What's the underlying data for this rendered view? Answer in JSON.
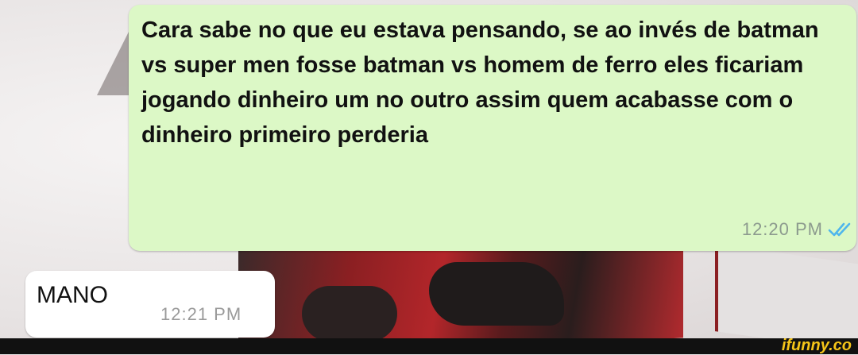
{
  "messages": {
    "sent": {
      "text": "Cara sabe no que eu estava pensando, se ao invés de batman vs super men fosse batman vs homem de ferro eles ficariam jogando dinheiro um no outro assim quem acabasse com o dinheiro primeiro perderia",
      "time": "12:20 PM",
      "status_icon": "double-check-icon",
      "status_color": "#4fb6ec"
    },
    "received": {
      "text": "MANO",
      "time": "12:21 PM"
    }
  },
  "watermark": {
    "brand": "ifunny.co",
    "color": "#f5c518"
  }
}
